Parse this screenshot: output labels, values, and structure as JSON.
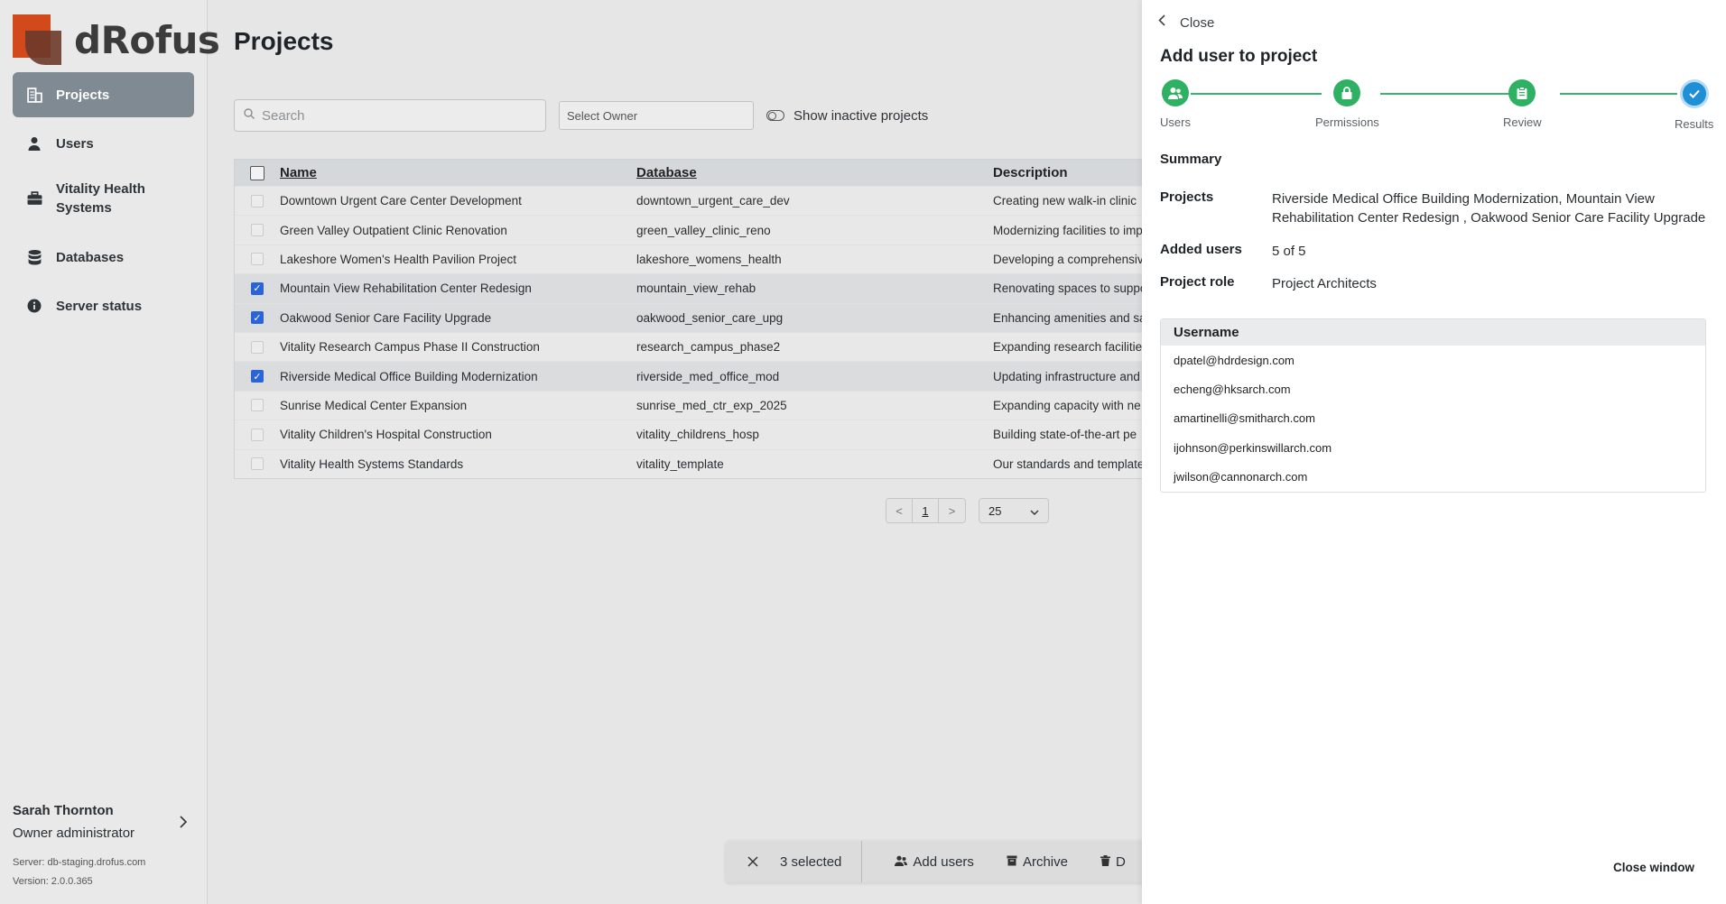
{
  "brand": {
    "name": "dRofus"
  },
  "sidebar": {
    "items": [
      {
        "label": "Projects",
        "icon": "building-icon",
        "active": true
      },
      {
        "label": "Users",
        "icon": "person-icon",
        "active": false
      },
      {
        "label": "Vitality Health Systems",
        "icon": "briefcase-icon",
        "active": false
      },
      {
        "label": "Databases",
        "icon": "database-icon",
        "active": false
      },
      {
        "label": "Server status",
        "icon": "info-icon",
        "active": false
      }
    ],
    "user": {
      "name": "Sarah Thornton",
      "role": "Owner administrator",
      "server": "Server: db-staging.drofus.com",
      "version": "Version: 2.0.0.365"
    }
  },
  "main": {
    "title": "Projects",
    "search": {
      "placeholder": "Search"
    },
    "owner_select": {
      "placeholder": "Select Owner"
    },
    "toggle_label": "Show inactive projects",
    "table": {
      "columns": {
        "name": "Name",
        "database": "Database",
        "description": "Description"
      },
      "rows": [
        {
          "name": "Downtown Urgent Care Center Development",
          "database": "downtown_urgent_care_dev",
          "description": "Creating new walk-in clinic",
          "selected": false
        },
        {
          "name": "Green Valley Outpatient Clinic Renovation",
          "database": "green_valley_clinic_reno",
          "description": "Modernizing facilities to imp",
          "selected": false
        },
        {
          "name": "Lakeshore Women's Health Pavilion Project",
          "database": "lakeshore_womens_health",
          "description": "Developing a comprehensiv",
          "selected": false
        },
        {
          "name": "Mountain View Rehabilitation Center Redesign",
          "database": "mountain_view_rehab",
          "description": "Renovating spaces to suppo",
          "selected": true
        },
        {
          "name": "Oakwood Senior Care Facility Upgrade",
          "database": "oakwood_senior_care_upg",
          "description": "Enhancing amenities and sa",
          "selected": true
        },
        {
          "name": "Vitality Research Campus Phase II Construction",
          "database": "research_campus_phase2",
          "description": "Expanding research facilitie",
          "selected": false
        },
        {
          "name": "Riverside Medical Office Building Modernization",
          "database": "riverside_med_office_mod",
          "description": "Updating infrastructure and",
          "selected": true
        },
        {
          "name": "Sunrise Medical Center Expansion",
          "database": "sunrise_med_ctr_exp_2025",
          "description": "Expanding capacity with ne",
          "selected": false
        },
        {
          "name": "Vitality Children's Hospital Construction",
          "database": "vitality_childrens_hosp",
          "description": "Building state-of-the-art pe",
          "selected": false
        },
        {
          "name": "Vitality Health Systems Standards",
          "database": "vitality_template",
          "description": "Our standards and template",
          "selected": false
        }
      ]
    },
    "pager": {
      "prev": "<",
      "page": "1",
      "next": ">",
      "page_size": "25"
    },
    "action_bar": {
      "selected_text": "3 selected",
      "add_users": "Add users",
      "archive": "Archive",
      "delete": "D"
    }
  },
  "drawer": {
    "close_label": "Close",
    "title": "Add user to project",
    "steps": [
      {
        "label": "Users",
        "icon": "users-icon"
      },
      {
        "label": "Permissions",
        "icon": "lock-icon"
      },
      {
        "label": "Review",
        "icon": "clipboard-icon"
      },
      {
        "label": "Results",
        "icon": "check-icon"
      }
    ],
    "summary_heading": "Summary",
    "projects_label": "Projects",
    "projects_value": "Riverside Medical Office Building Modernization, Mountain View Rehabilitation Center Redesign , Oakwood Senior Care Facility Upgrade",
    "added_users_label": "Added users",
    "added_users_value": "5 of 5",
    "project_role_label": "Project role",
    "project_role_value": "Project Architects",
    "users_table": {
      "header": "Username",
      "rows": [
        "dpatel@hdrdesign.com",
        "echeng@hksarch.com",
        "amartinelli@smitharch.com",
        "ijohnson@perkinswillarch.com",
        "jwilson@cannonarch.com"
      ]
    },
    "close_window": "Close window"
  },
  "colors": {
    "accent": "#2b63d9",
    "step_done": "#2fb163",
    "step_current": "#1f8fd6",
    "brand": "#d24a1c"
  }
}
